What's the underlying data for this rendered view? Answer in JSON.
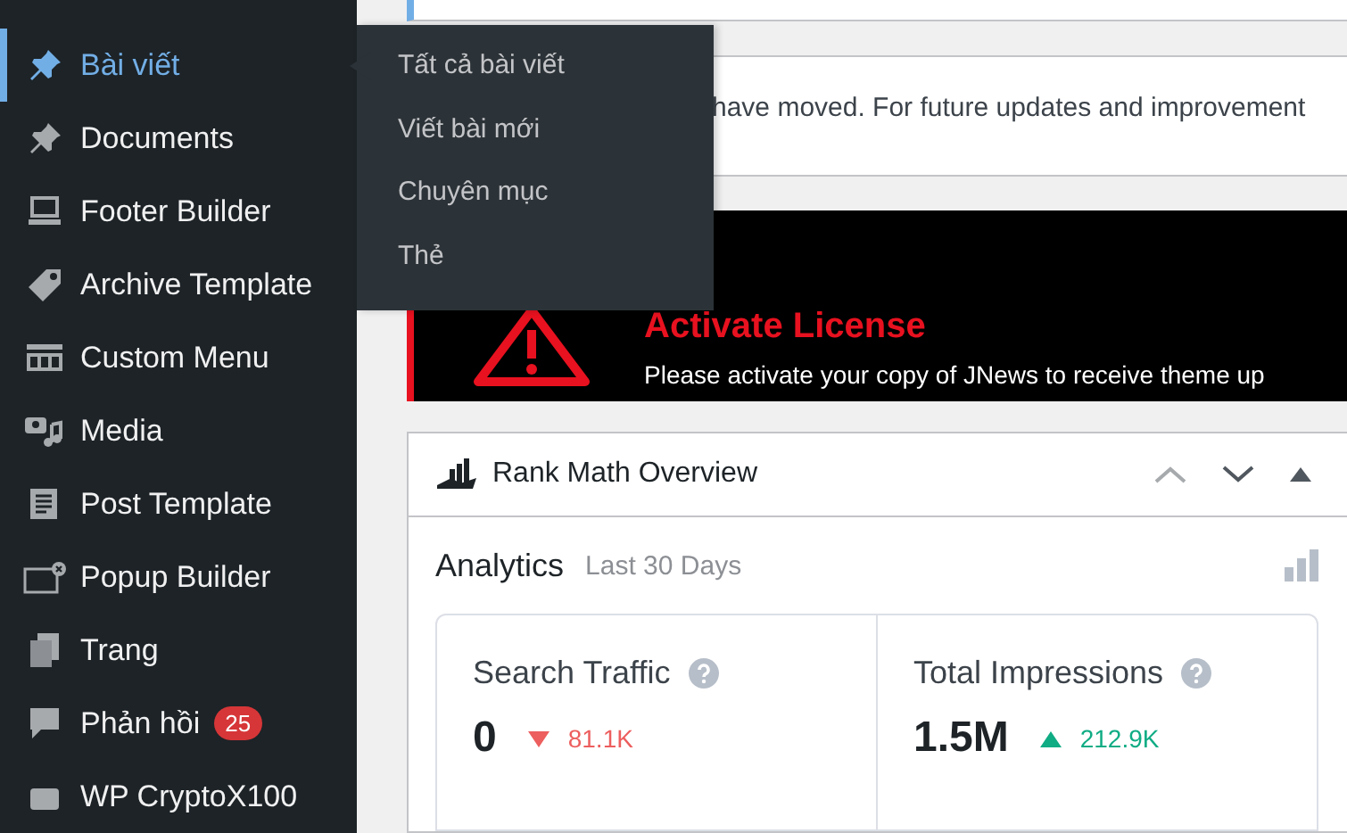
{
  "sidebar": {
    "items": [
      {
        "label": "Bài viết",
        "selected": true
      },
      {
        "label": "Documents",
        "selected": false
      },
      {
        "label": "Footer Builder",
        "selected": false
      },
      {
        "label": "Archive Template",
        "selected": false
      },
      {
        "label": "Custom Menu",
        "selected": false
      },
      {
        "label": "Media",
        "selected": false
      },
      {
        "label": "Post Template",
        "selected": false
      },
      {
        "label": "Popup Builder",
        "selected": false
      },
      {
        "label": "Trang",
        "selected": false
      },
      {
        "label": "Phản hồi",
        "selected": false,
        "badge": "25"
      },
      {
        "label": "WP CryptoX100",
        "selected": false
      }
    ]
  },
  "flyout": {
    "items": [
      "Tất cả bài viết",
      "Viết bài mới",
      "Chuyên mục",
      "Thẻ"
    ]
  },
  "notice": {
    "text": "have moved. For future updates and improvement"
  },
  "license": {
    "title": "Activate License",
    "text": "Please activate your copy of JNews to receive theme up"
  },
  "widget": {
    "title": "Rank Math Overview",
    "section": "Analytics",
    "period": "Last 30 Days",
    "stats": [
      {
        "label": "Search Traffic",
        "value": "0",
        "rising": false,
        "change": "81.1K"
      },
      {
        "label": "Total Impressions",
        "value": "1.5M",
        "rising": true,
        "change": "212.9K"
      }
    ]
  }
}
